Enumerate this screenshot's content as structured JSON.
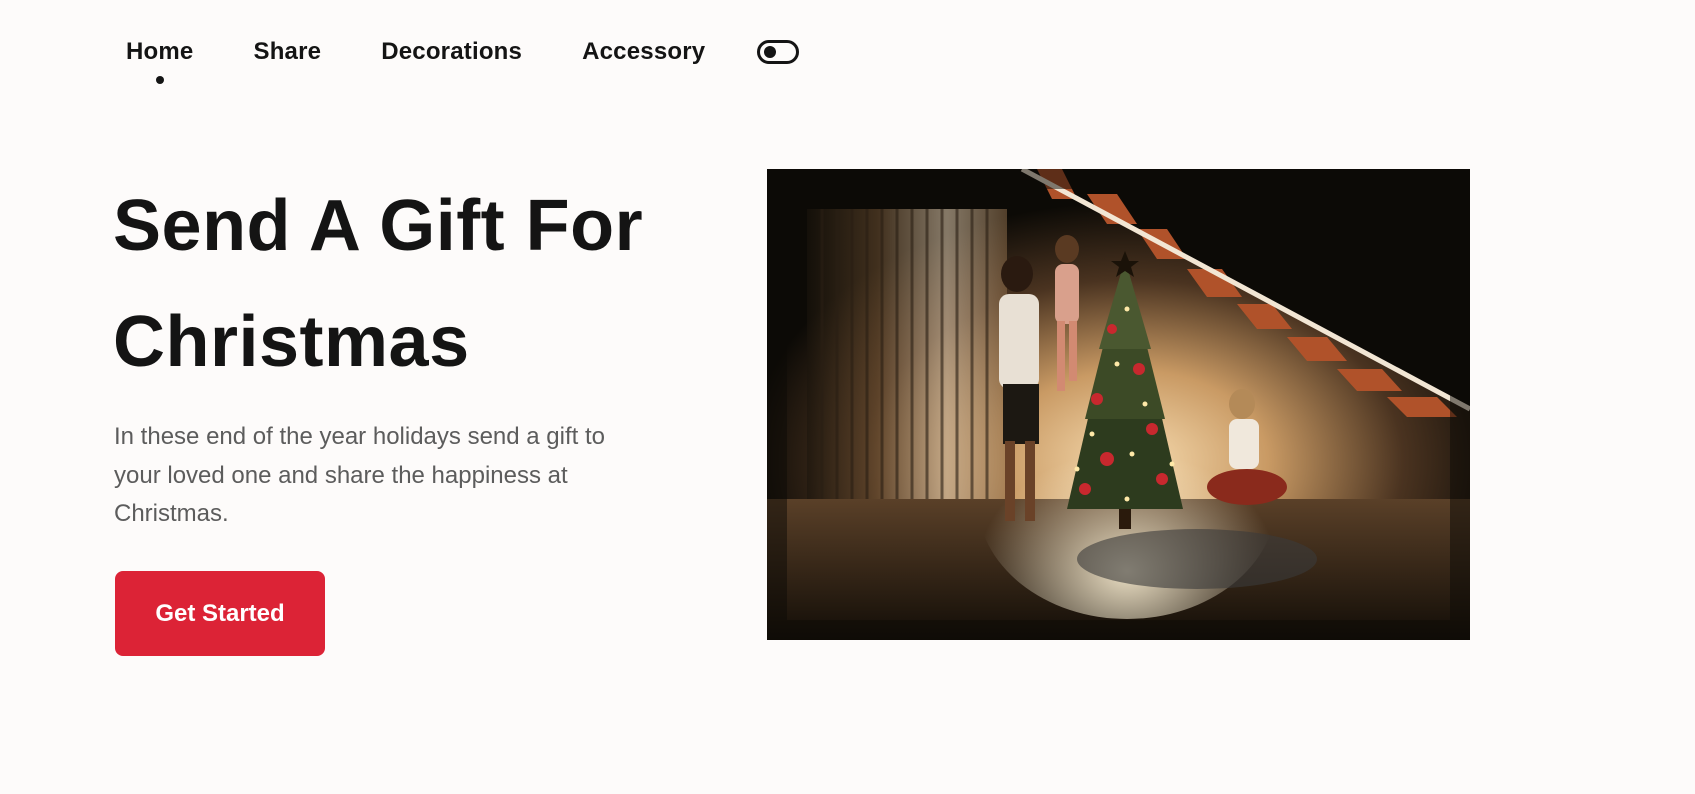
{
  "nav": {
    "items": [
      {
        "label": "Home",
        "active": true
      },
      {
        "label": "Share",
        "active": false
      },
      {
        "label": "Decorations",
        "active": false
      },
      {
        "label": "Accessory",
        "active": false
      }
    ],
    "theme_toggle_icon": "toggle-icon"
  },
  "hero": {
    "title_line1": "Send A Gift For",
    "title_line2": "Christmas",
    "description": "In these end of the year holidays send a gift to your loved one and share the happiness at Christmas.",
    "cta_label": "Get Started",
    "image_icon": "family-decorating-christmas-tree-photo"
  },
  "colors": {
    "background": "#fdfbfa",
    "text": "#141414",
    "muted_text": "#5c5c5c",
    "accent": "#dc2336"
  }
}
